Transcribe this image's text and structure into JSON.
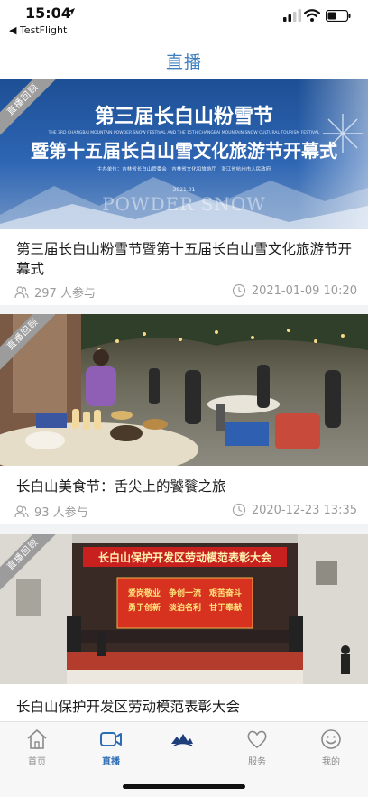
{
  "status_bar": {
    "time": "15:04",
    "back_app": "◀ TestFlight"
  },
  "nav": {
    "title": "直播"
  },
  "badge_label": "直播回顾",
  "cards": [
    {
      "banner": {
        "title_line1": "第三届长白山粉雪节",
        "title_line2": "暨第十五届长白山雪文化旅游节开幕式",
        "subtitle_en": "THE 3RD CHANGBAI MOUNTAIN POWDER SNOW FESTIVAL AND THE 15TH CHANGBAI MOUNTAIN SNOW CULTURAL TOURISM FESTIVAL",
        "organizers": "主办单位：吉林省长白山管委会　吉林省文化和旅游厅　浙江省杭州市人民政府",
        "date": "2021.01",
        "watermark": "POWDER SNOW"
      },
      "title": "第三届长白山粉雪节暨第十五届长白山雪文化旅游节开幕式",
      "participants": "297 人参与",
      "datetime": "2021-01-09 10:20"
    },
    {
      "title": "长白山美食节：舌尖上的饕餮之旅",
      "participants": "93 人参与",
      "datetime": "2020-12-23 13:35"
    },
    {
      "banner": {
        "stage_banner": "长白山保护开发区劳动模范表彰大会",
        "screen_line1": "爱岗敬业　争创一流　艰苦奋斗",
        "screen_line2": "勇于创新　淡泊名利　甘于奉献"
      },
      "title": "长白山保护开发区劳动模范表彰大会"
    }
  ],
  "tabs": [
    {
      "label": "首页",
      "icon": "home-icon"
    },
    {
      "label": "直播",
      "icon": "video-camera-icon",
      "active": true
    },
    {
      "label": "",
      "icon": "changbaishan-logo"
    },
    {
      "label": "服务",
      "icon": "heart-icon"
    },
    {
      "label": "我的",
      "icon": "smiley-icon"
    }
  ],
  "colors": {
    "accent": "#2b6cb3",
    "title_blue": "#3f7fc0",
    "meta_gray": "#9a9a9a"
  }
}
